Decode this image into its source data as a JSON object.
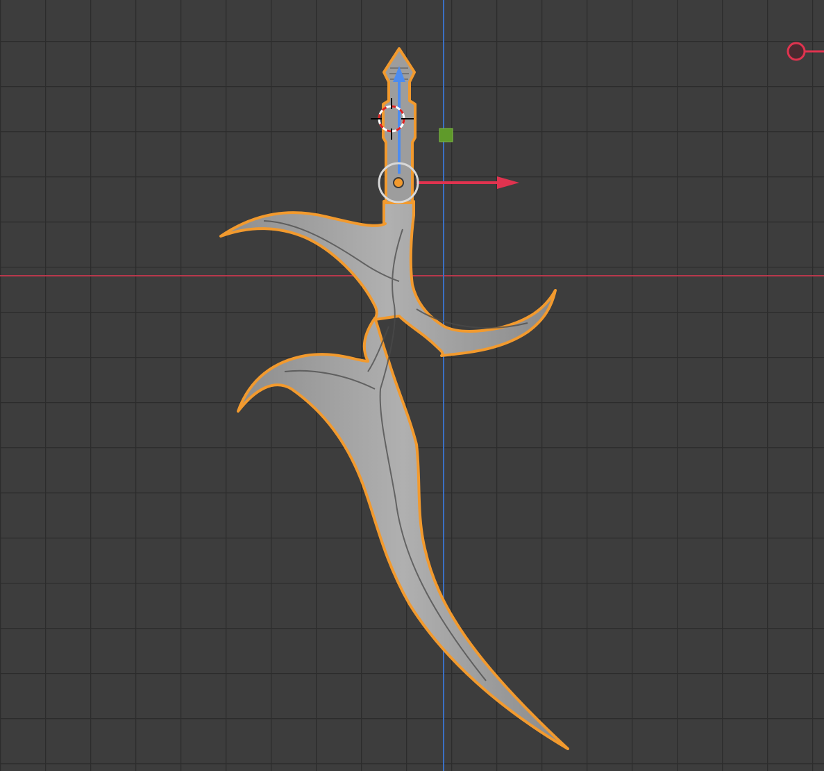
{
  "viewport": {
    "view": "front-orthographic",
    "grid_visible": true,
    "axis_colors": {
      "x_axis": "#b8384c",
      "z_axis": "#3a6fc4"
    }
  },
  "object": {
    "selected": true,
    "outline_color": "#f29a2e",
    "surface_color": "#a3a3a3"
  },
  "gizmo": {
    "x_arrow_color": "#e0334f",
    "z_arrow_color": "#4c8cf0",
    "plane_handle_color": "#5f9a2a",
    "origin_color": "#f29a2e"
  },
  "cursor_3d": {
    "ring_colors": [
      "#e02020",
      "#ffffff"
    ]
  },
  "navigation": {
    "x_axis_icon": "x-axis-gizmo-icon",
    "x_axis_icon_color": "#e0334f"
  }
}
